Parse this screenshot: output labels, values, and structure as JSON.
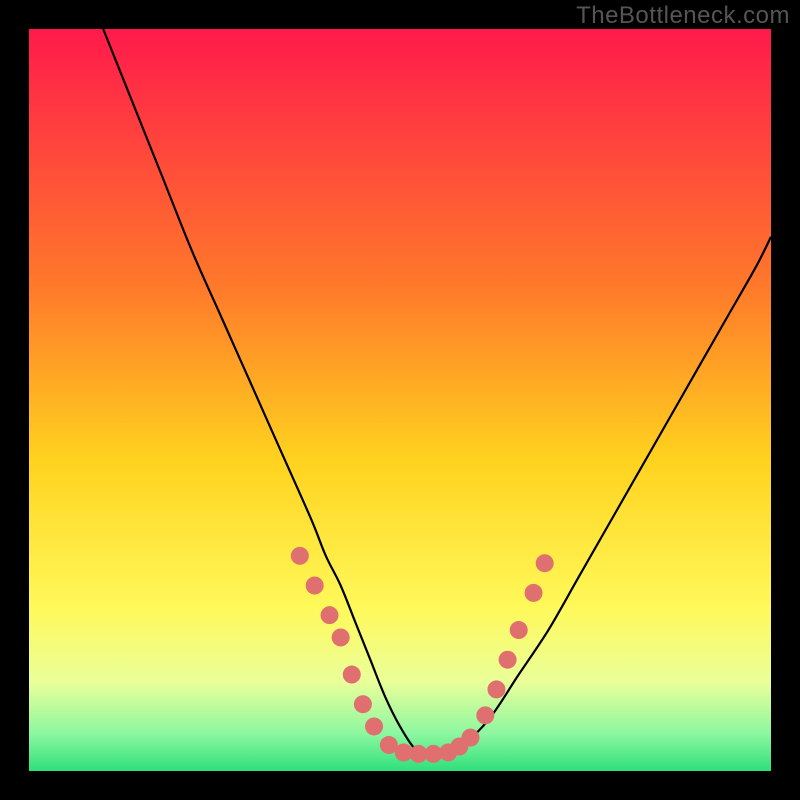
{
  "watermark": "TheBottleneck.com",
  "chart_data": {
    "type": "line",
    "title": "",
    "xlabel": "",
    "ylabel": "",
    "xlim": [
      0,
      100
    ],
    "ylim": [
      0,
      100
    ],
    "background_gradient": {
      "stops": [
        {
          "offset": 0,
          "color": "#ff1a4b"
        },
        {
          "offset": 35,
          "color": "#ff7a2a"
        },
        {
          "offset": 58,
          "color": "#ffd21e"
        },
        {
          "offset": 78,
          "color": "#fff95a"
        },
        {
          "offset": 88,
          "color": "#eaff9a"
        },
        {
          "offset": 95,
          "color": "#8cf7a0"
        },
        {
          "offset": 100,
          "color": "#2ee07b"
        }
      ]
    },
    "series": [
      {
        "name": "bottleneck-curve",
        "color": "#000000",
        "x": [
          10,
          14,
          18,
          22,
          26,
          30,
          34,
          38,
          40,
          42,
          44,
          46,
          48,
          50,
          52,
          54,
          56,
          58,
          62,
          66,
          70,
          74,
          78,
          82,
          86,
          90,
          94,
          98,
          100
        ],
        "y": [
          100,
          90,
          80,
          70,
          61,
          52,
          43,
          34,
          29,
          25,
          20,
          15,
          10,
          6,
          3,
          2,
          2,
          3,
          7,
          13,
          19,
          26,
          33,
          40,
          47,
          54,
          61,
          68,
          72
        ]
      }
    ],
    "scatter": {
      "name": "highlight-points",
      "color": "#e07070",
      "radius": 9,
      "points": [
        {
          "x": 36.5,
          "y": 29
        },
        {
          "x": 38.5,
          "y": 25
        },
        {
          "x": 40.5,
          "y": 21
        },
        {
          "x": 42.0,
          "y": 18
        },
        {
          "x": 43.5,
          "y": 13
        },
        {
          "x": 45.0,
          "y": 9
        },
        {
          "x": 46.5,
          "y": 6
        },
        {
          "x": 48.5,
          "y": 3.5
        },
        {
          "x": 50.5,
          "y": 2.5
        },
        {
          "x": 52.5,
          "y": 2.3
        },
        {
          "x": 54.5,
          "y": 2.3
        },
        {
          "x": 56.5,
          "y": 2.5
        },
        {
          "x": 58.0,
          "y": 3.3
        },
        {
          "x": 59.5,
          "y": 4.5
        },
        {
          "x": 61.5,
          "y": 7.5
        },
        {
          "x": 63.0,
          "y": 11
        },
        {
          "x": 64.5,
          "y": 15
        },
        {
          "x": 66.0,
          "y": 19
        },
        {
          "x": 68.0,
          "y": 24
        },
        {
          "x": 69.5,
          "y": 28
        }
      ]
    }
  }
}
